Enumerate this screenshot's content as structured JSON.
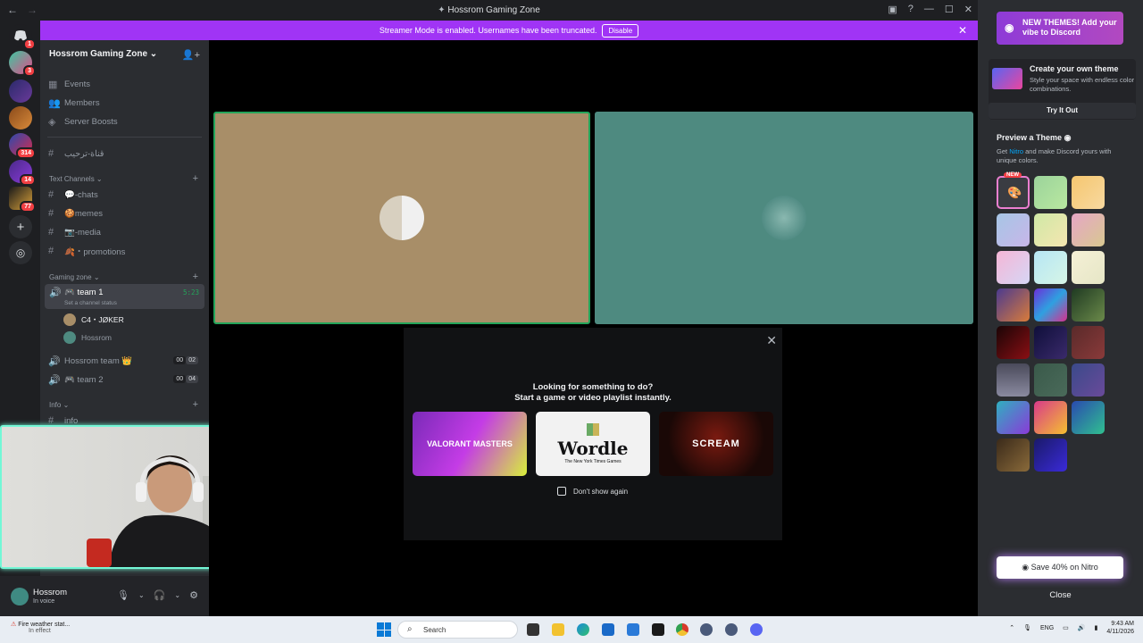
{
  "window": {
    "title": "Hossrom Gaming Zone"
  },
  "banner": {
    "text": "Streamer Mode is enabled. Usernames have been truncated.",
    "disable_label": "Disable"
  },
  "rail": {
    "badges": [
      "1",
      "3",
      "",
      "",
      "314",
      "14",
      "77"
    ]
  },
  "sidebar": {
    "guild_name": "Hossrom Gaming Zone",
    "top_items": [
      "Events",
      "Members",
      "Server Boosts"
    ],
    "welcome_channel": "قناة-ترحيب",
    "categories": {
      "text": "Text Channels",
      "gaming": "Gaming zone",
      "info": "Info"
    },
    "text_channels": [
      "💬-chats",
      "🍪memes",
      "📷-media",
      "🍂・promotions"
    ],
    "voice": {
      "active": {
        "name": "🎮 team 1",
        "timer": "5:23",
        "status": "Set a channel status"
      },
      "members": [
        "C4・JØKER",
        "Hossrom"
      ],
      "others": [
        {
          "name": "Hossrom team 👑",
          "count_a": "00",
          "count_b": "02"
        },
        {
          "name": "🎮 team 2",
          "count_a": "00",
          "count_b": "04"
        }
      ]
    },
    "info_channel": "info"
  },
  "user_panel": {
    "name": "Hossrom",
    "status": "In voice"
  },
  "activity": {
    "line1": "Looking for something to do?",
    "line2": "Start a game or video playlist instantly.",
    "cards": [
      {
        "label": "VALORANT MASTERS"
      },
      {
        "label": "Wordle",
        "sub": "The New York Times Games"
      },
      {
        "label": "SCREAM"
      }
    ],
    "dont_show": "Don't show again"
  },
  "theme_panel": {
    "promo": "NEW THEMES! Add your vibe to Discord",
    "create_title": "Create your own theme",
    "create_desc": "Style your space with endless color combinations.",
    "try_label": "Try It Out",
    "preview_title": "Preview a Theme",
    "preview_desc_pre": "Get ",
    "preview_desc_link": "Nitro",
    "preview_desc_post": " and make Discord yours with unique colors.",
    "new_badge": "NEW",
    "save_label": "Save 40% on Nitro",
    "close_label": "Close",
    "swatches": [
      "#3a3c42",
      "linear-gradient(135deg,#9bd39b,#b9e8a0)",
      "linear-gradient(135deg,#f5c66f,#f8d9a0)",
      "linear-gradient(135deg,#a6c6e6,#c8b6e8)",
      "linear-gradient(135deg,#cfe8a6,#f5e6b0)",
      "linear-gradient(135deg,#e6a6c6,#d8c890)",
      "linear-gradient(135deg,#f5b6d6,#d6d6f5)",
      "linear-gradient(135deg,#b6e6f5,#d6f5e6)",
      "linear-gradient(135deg,#f5f0d6,#e6e6c6)",
      "linear-gradient(135deg,#4b3a8f,#d97b3a)",
      "linear-gradient(135deg,#6b2fd8,#2fa0e0,#d82f8f)",
      "linear-gradient(135deg,#1f3a22,#6b8a4a)",
      "linear-gradient(135deg,#1a0506,#8a0f14)",
      "linear-gradient(135deg,#0f0f3a,#3a2a6b)",
      "linear-gradient(135deg,#5a2a2a,#8a3a3a)",
      "linear-gradient(180deg,#4a4a5a,#8a8aa0)",
      "linear-gradient(135deg,#3a5a4a,#4a6a5a)",
      "linear-gradient(135deg,#3a4a8a,#6a4a9a)",
      "linear-gradient(135deg,#2fb0c0,#8a3ad8)",
      "linear-gradient(135deg,#d83a8a,#f5c030)",
      "linear-gradient(135deg,#2a4ab0,#30c090)",
      "linear-gradient(135deg,#3a2a1a,#8a6a3a)",
      "linear-gradient(135deg,#1a1a6a,#3a2ad8)"
    ]
  },
  "taskbar": {
    "weather_title": "Fire weather stat...",
    "weather_sub": "In effect",
    "search_label": "Search",
    "lang": "ENG",
    "time": "9:43 AM",
    "date": "4/11/2026"
  }
}
